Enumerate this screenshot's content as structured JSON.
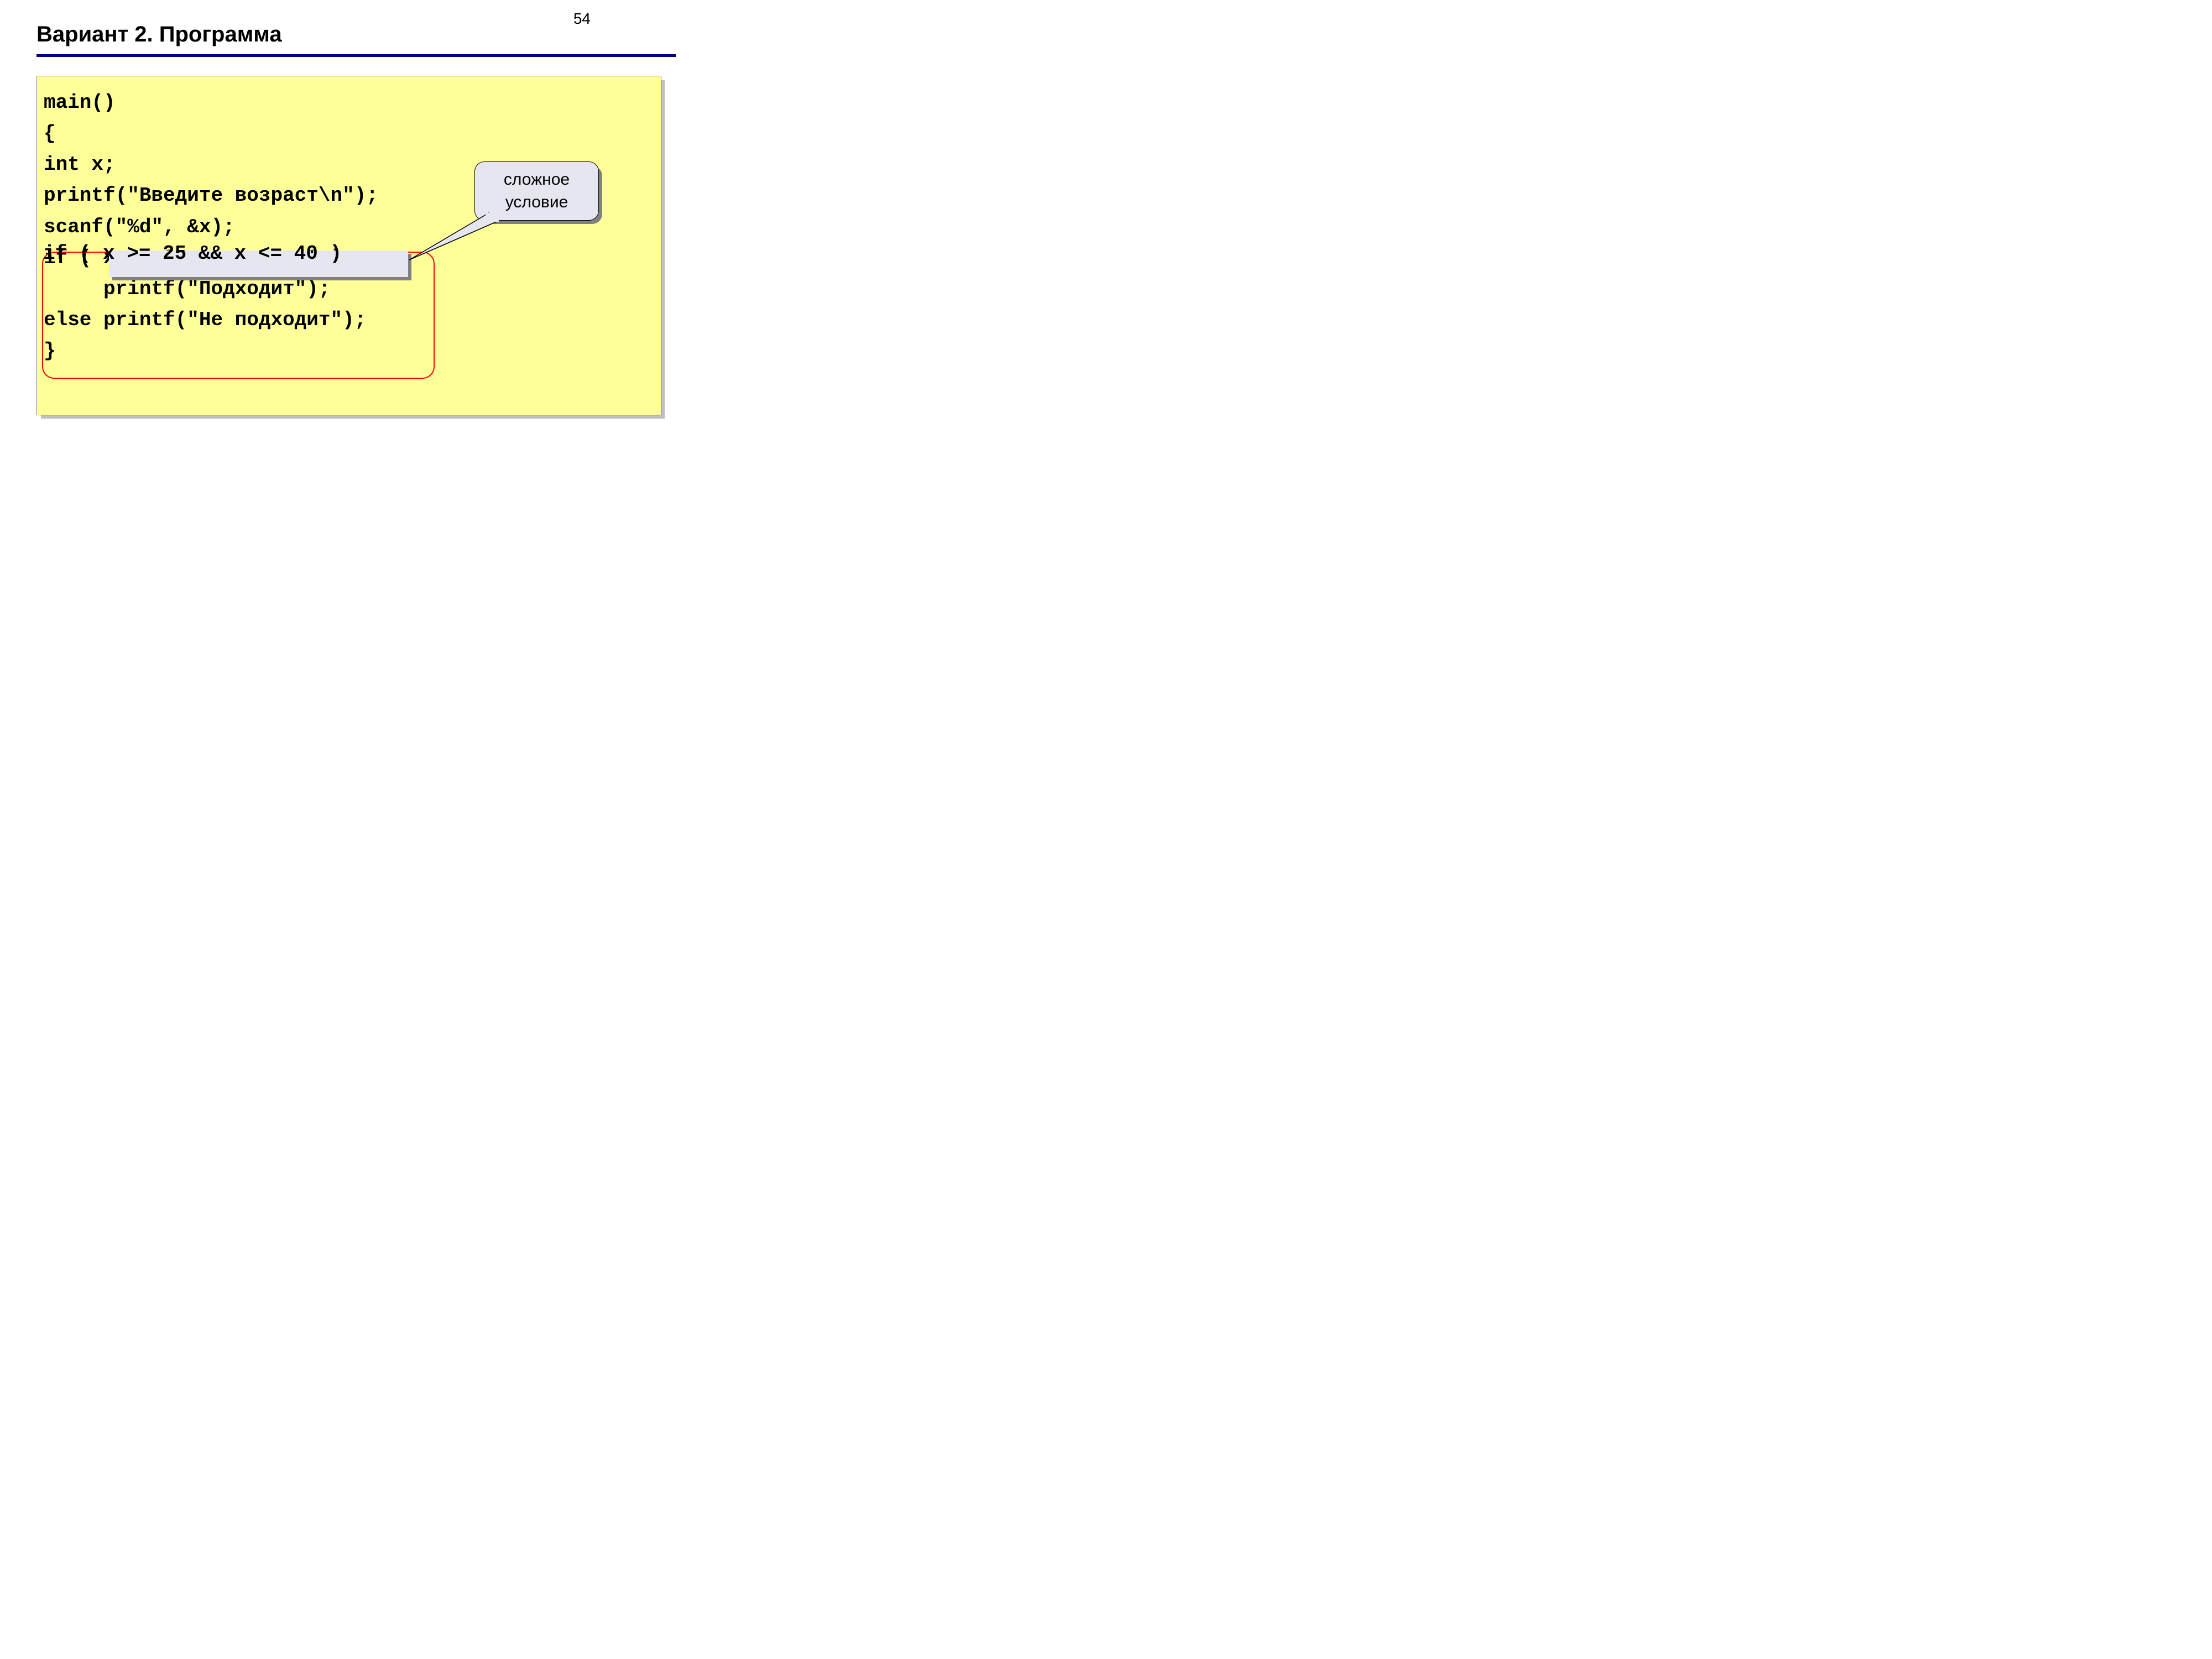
{
  "page_number": "54",
  "title": "Вариант 2. Программа",
  "code": {
    "l1": "main()",
    "l2": "{",
    "l3": "int x;",
    "l4": "printf(\"Введите возраст\\n\");",
    "l5": "scanf(\"%d\", &x);",
    "l6": "if ( x >= 25 && x <= 40 )",
    "l7": "     printf(\"Подходит\");",
    "l8": "else printf(\"Не подходит\");",
    "l9": "}"
  },
  "callout": {
    "line1": "сложное",
    "line2": "условие"
  }
}
